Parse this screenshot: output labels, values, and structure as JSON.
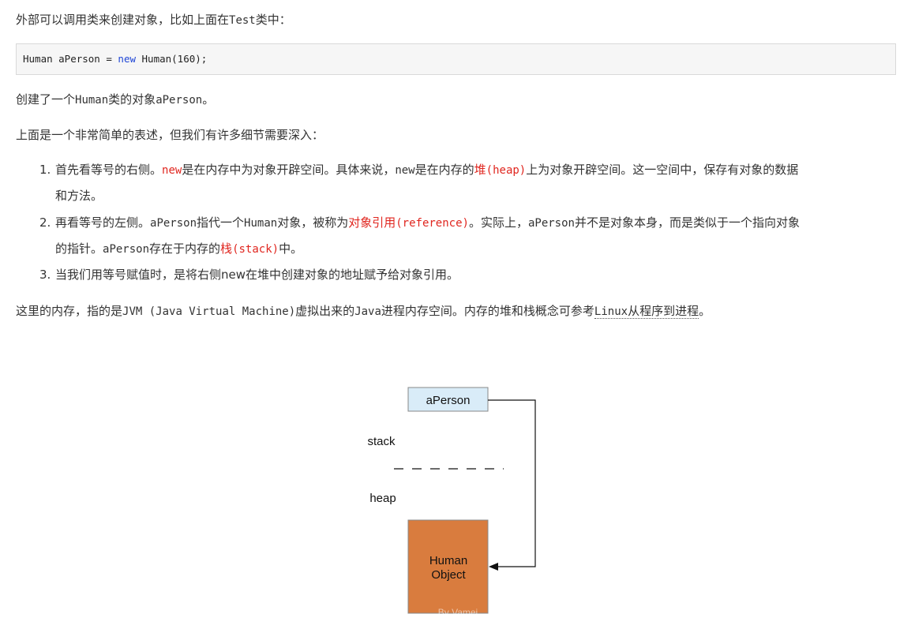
{
  "intro": {
    "text_before": "外部可以调用类来创建对象，比如上面在",
    "code_class": "Test",
    "text_after": "类中："
  },
  "code": {
    "part1": "Human aPerson = ",
    "keyword": "new",
    "part2": " Human(160);"
  },
  "created": {
    "t1": "创建了一个",
    "c1": "Human",
    "t2": "类的对象",
    "c2": "aPerson",
    "t3": "。"
  },
  "detail_intro": "上面是一个非常简单的表述，但我们有许多细节需要深入：",
  "list": [
    {
      "num": "1.",
      "s1": "首先看等号的右侧。",
      "c1": "new",
      "s2": "是在内存中为对象开辟空间。具体来说，",
      "c2": "new",
      "s3": "是在内存的",
      "red_text": "堆",
      "red_code": "(heap)",
      "s4": "上为对象开辟空间。这一空间中，保存有对象的数据",
      "line2": "和方法。"
    },
    {
      "num": "2.",
      "s1": "再看等号的左侧。",
      "c1": "aPerson",
      "s2": "指代一个",
      "c2": "Human",
      "s3": "对象，被称为",
      "red_text": "对象引用",
      "red_code": "(reference)",
      "s4": "。实际上，",
      "c3": "aPerson",
      "s5": "并不是对象本身，而是类似于一个指向对象",
      "line2_t1": "的指针。",
      "line2_c1": "aPerson",
      "line2_t2": "存在于内存的",
      "line2_red_text": "栈",
      "line2_red_code": "(stack)",
      "line2_t3": "中。"
    },
    {
      "num": "3.",
      "text": "当我们用等号赋值时，是将右侧new在堆中创建对象的地址赋予给对象引用。"
    }
  ],
  "memory": {
    "t1": "这里的内存，指的是",
    "c1": "JVM (Java Virtual Machine)",
    "t2": "虚拟出来的",
    "c2": "Java",
    "t3": "进程内存空间。内存的堆和栈概念可参考",
    "link_code": "Linux",
    "link_text": "从程序到进程",
    "t4": "。"
  },
  "diagram": {
    "ref_label": "aPerson",
    "stack_label": "stack",
    "heap_label": "heap",
    "object_line1": "Human",
    "object_line2": "Object",
    "watermark": "By Vamei",
    "colors": {
      "ref_fill": "#d9ecf8",
      "object_fill": "#d97c3e",
      "box_stroke": "#888888",
      "arrow": "#111111"
    }
  }
}
